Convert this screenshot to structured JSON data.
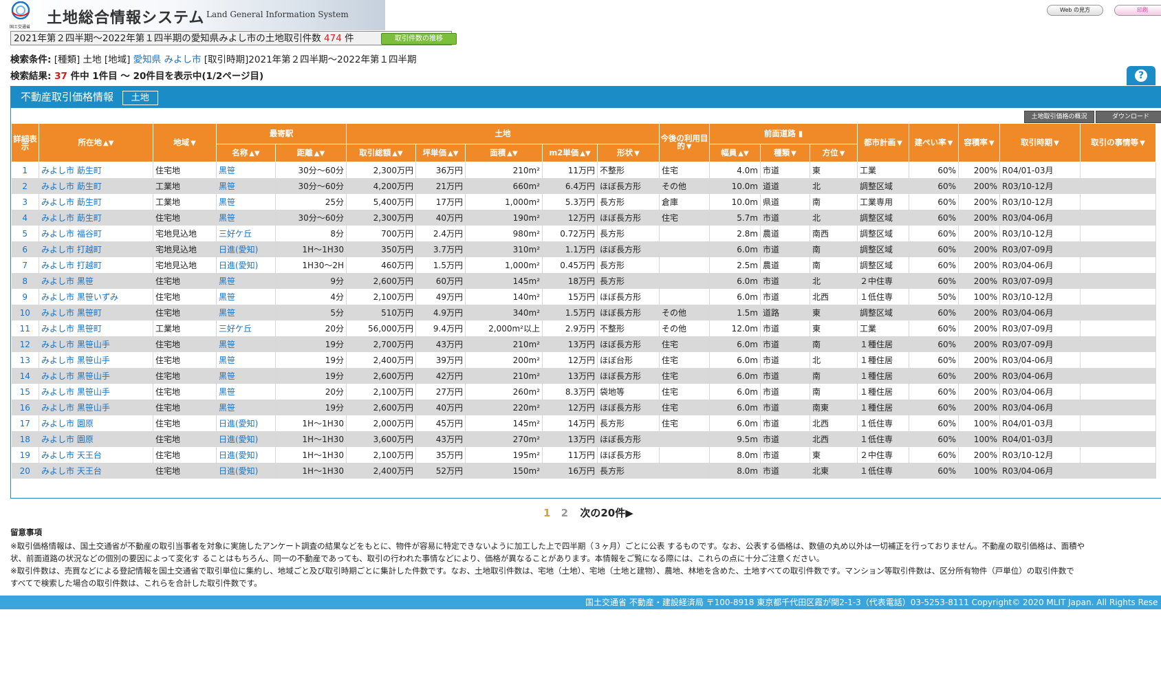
{
  "header": {
    "title": "土地総合情報システム",
    "subtitle": "Land General Information System",
    "ministry_logo_text": "国土交通省",
    "btn_web": "Web の見方",
    "btn_print": "印刷"
  },
  "summary": {
    "text_before": "2021年第２四半期〜2022年第１四半期の愛知県みよし市の土地取引件数",
    "count": "474",
    "unit": "件",
    "trend_button": "取引件数の推移"
  },
  "conditions": {
    "label": "検索条件:",
    "type": "[種類] 土地",
    "region_label": "[地域]",
    "pref": "愛知県",
    "city": "みよし市",
    "period": "[取引時期]2021年第２四半期〜2022年第１四半期"
  },
  "result": {
    "label": "検索結果:",
    "count": "37",
    "text": "件中 1件目 〜 20件目を表示中(1/2ページ目)"
  },
  "panel": {
    "title": "不動産取引価格情報",
    "tag": "土地",
    "overview_button": "土地取引価格の概況",
    "download_button": "ダウンロード"
  },
  "columns": {
    "detail": "詳細表示",
    "location": "所在地",
    "district": "地域",
    "station_group": "最寄駅",
    "station_name": "名称",
    "distance": "距離",
    "land_group": "土地",
    "total": "取引総額",
    "tsubo": "坪単価",
    "area": "面積",
    "m2price": "m2単価",
    "shape": "形状",
    "future_use": "今後の利用目的",
    "road_group": "前面道路",
    "width": "幅員",
    "road_type": "種類",
    "direction": "方位",
    "city_plan": "都市計画",
    "coverage": "建ぺい率",
    "far": "容積率",
    "period": "取引時期",
    "circumstances": "取引の事情等"
  },
  "rows": [
    {
      "no": "1",
      "loc": "みよし市 莇生町",
      "dist": "住宅地",
      "st": "黒笹",
      "d": "30分〜60分",
      "total": "2,300万円",
      "tsubo": "36万円",
      "area": "210m²",
      "m2": "11万円",
      "shape": "不整形",
      "use": "住宅",
      "w": "4.0m",
      "rt": "市道",
      "dir": "東",
      "plan": "工業",
      "cov": "60%",
      "far": "200%",
      "per": "R04/01-03月"
    },
    {
      "no": "2",
      "loc": "みよし市 莇生町",
      "dist": "工業地",
      "st": "黒笹",
      "d": "30分〜60分",
      "total": "4,200万円",
      "tsubo": "21万円",
      "area": "660m²",
      "m2": "6.4万円",
      "shape": "ほぼ長方形",
      "use": "その他",
      "w": "10.0m",
      "rt": "道道",
      "dir": "北",
      "plan": "調整区域",
      "cov": "60%",
      "far": "200%",
      "per": "R03/10-12月"
    },
    {
      "no": "3",
      "loc": "みよし市 莇生町",
      "dist": "工業地",
      "st": "黒笹",
      "d": "25分",
      "total": "5,400万円",
      "tsubo": "17万円",
      "area": "1,000m²",
      "m2": "5.3万円",
      "shape": "長方形",
      "use": "倉庫",
      "w": "10.0m",
      "rt": "県道",
      "dir": "南",
      "plan": "工業専用",
      "cov": "60%",
      "far": "200%",
      "per": "R03/10-12月"
    },
    {
      "no": "4",
      "loc": "みよし市 莇生町",
      "dist": "住宅地",
      "st": "黒笹",
      "d": "30分〜60分",
      "total": "2,300万円",
      "tsubo": "40万円",
      "area": "190m²",
      "m2": "12万円",
      "shape": "ほぼ長方形",
      "use": "住宅",
      "w": "5.7m",
      "rt": "市道",
      "dir": "北",
      "plan": "調整区域",
      "cov": "60%",
      "far": "200%",
      "per": "R03/04-06月"
    },
    {
      "no": "5",
      "loc": "みよし市 福谷町",
      "dist": "宅地見込地",
      "st": "三好ケ丘",
      "d": "8分",
      "total": "700万円",
      "tsubo": "2.4万円",
      "area": "980m²",
      "m2": "0.72万円",
      "shape": "長方形",
      "use": "",
      "w": "2.8m",
      "rt": "農道",
      "dir": "南西",
      "plan": "調整区域",
      "cov": "60%",
      "far": "200%",
      "per": "R03/10-12月"
    },
    {
      "no": "6",
      "loc": "みよし市 打越町",
      "dist": "宅地見込地",
      "st": "日進(愛知)",
      "d": "1H〜1H30",
      "total": "350万円",
      "tsubo": "3.7万円",
      "area": "310m²",
      "m2": "1.1万円",
      "shape": "ほぼ長方形",
      "use": "",
      "w": "6.0m",
      "rt": "市道",
      "dir": "南",
      "plan": "調整区域",
      "cov": "60%",
      "far": "200%",
      "per": "R03/07-09月"
    },
    {
      "no": "7",
      "loc": "みよし市 打越町",
      "dist": "宅地見込地",
      "st": "日進(愛知)",
      "d": "1H30〜2H",
      "total": "460万円",
      "tsubo": "1.5万円",
      "area": "1,000m²",
      "m2": "0.45万円",
      "shape": "長方形",
      "use": "",
      "w": "2.5m",
      "rt": "農道",
      "dir": "南",
      "plan": "調整区域",
      "cov": "60%",
      "far": "200%",
      "per": "R03/04-06月"
    },
    {
      "no": "8",
      "loc": "みよし市 黒笹",
      "dist": "住宅地",
      "st": "黒笹",
      "d": "9分",
      "total": "2,600万円",
      "tsubo": "60万円",
      "area": "145m²",
      "m2": "18万円",
      "shape": "長方形",
      "use": "",
      "w": "6.0m",
      "rt": "市道",
      "dir": "北",
      "plan": "２中住専",
      "cov": "60%",
      "far": "200%",
      "per": "R03/07-09月"
    },
    {
      "no": "9",
      "loc": "みよし市 黒笹いずみ",
      "dist": "住宅地",
      "st": "黒笹",
      "d": "4分",
      "total": "2,100万円",
      "tsubo": "49万円",
      "area": "140m²",
      "m2": "15万円",
      "shape": "ほぼ長方形",
      "use": "",
      "w": "6.0m",
      "rt": "市道",
      "dir": "北西",
      "plan": "１低住専",
      "cov": "50%",
      "far": "100%",
      "per": "R03/10-12月"
    },
    {
      "no": "10",
      "loc": "みよし市 黒笹町",
      "dist": "住宅地",
      "st": "黒笹",
      "d": "5分",
      "total": "510万円",
      "tsubo": "4.9万円",
      "area": "340m²",
      "m2": "1.5万円",
      "shape": "ほぼ長方形",
      "use": "その他",
      "w": "1.5m",
      "rt": "道路",
      "dir": "東",
      "plan": "調整区域",
      "cov": "60%",
      "far": "200%",
      "per": "R03/04-06月"
    },
    {
      "no": "11",
      "loc": "みよし市 黒笹町",
      "dist": "工業地",
      "st": "三好ケ丘",
      "d": "20分",
      "total": "56,000万円",
      "tsubo": "9.4万円",
      "area": "2,000m²以上",
      "m2": "2.9万円",
      "shape": "不整形",
      "use": "その他",
      "w": "12.0m",
      "rt": "市道",
      "dir": "東",
      "plan": "工業",
      "cov": "60%",
      "far": "200%",
      "per": "R03/07-09月"
    },
    {
      "no": "12",
      "loc": "みよし市 黒笹山手",
      "dist": "住宅地",
      "st": "黒笹",
      "d": "19分",
      "total": "2,700万円",
      "tsubo": "43万円",
      "area": "210m²",
      "m2": "13万円",
      "shape": "ほぼ長方形",
      "use": "住宅",
      "w": "6.0m",
      "rt": "市道",
      "dir": "南",
      "plan": "１種住居",
      "cov": "60%",
      "far": "200%",
      "per": "R03/07-09月"
    },
    {
      "no": "13",
      "loc": "みよし市 黒笹山手",
      "dist": "住宅地",
      "st": "黒笹",
      "d": "19分",
      "total": "2,400万円",
      "tsubo": "39万円",
      "area": "200m²",
      "m2": "12万円",
      "shape": "ほぼ台形",
      "use": "住宅",
      "w": "6.0m",
      "rt": "市道",
      "dir": "北",
      "plan": "１種住居",
      "cov": "60%",
      "far": "200%",
      "per": "R03/04-06月"
    },
    {
      "no": "14",
      "loc": "みよし市 黒笹山手",
      "dist": "住宅地",
      "st": "黒笹",
      "d": "19分",
      "total": "2,600万円",
      "tsubo": "42万円",
      "area": "210m²",
      "m2": "13万円",
      "shape": "ほぼ長方形",
      "use": "住宅",
      "w": "6.0m",
      "rt": "市道",
      "dir": "南",
      "plan": "１種住居",
      "cov": "60%",
      "far": "200%",
      "per": "R03/04-06月"
    },
    {
      "no": "15",
      "loc": "みよし市 黒笹山手",
      "dist": "住宅地",
      "st": "黒笹",
      "d": "20分",
      "total": "2,100万円",
      "tsubo": "27万円",
      "area": "260m²",
      "m2": "8.3万円",
      "shape": "袋地等",
      "use": "住宅",
      "w": "6.0m",
      "rt": "市道",
      "dir": "南",
      "plan": "１種住居",
      "cov": "60%",
      "far": "200%",
      "per": "R03/04-06月"
    },
    {
      "no": "16",
      "loc": "みよし市 黒笹山手",
      "dist": "住宅地",
      "st": "黒笹",
      "d": "19分",
      "total": "2,600万円",
      "tsubo": "40万円",
      "area": "220m²",
      "m2": "12万円",
      "shape": "ほぼ長方形",
      "use": "住宅",
      "w": "6.0m",
      "rt": "市道",
      "dir": "南東",
      "plan": "１種住居",
      "cov": "60%",
      "far": "200%",
      "per": "R03/04-06月"
    },
    {
      "no": "17",
      "loc": "みよし市 園原",
      "dist": "住宅地",
      "st": "日進(愛知)",
      "d": "1H〜1H30",
      "total": "2,000万円",
      "tsubo": "45万円",
      "area": "145m²",
      "m2": "14万円",
      "shape": "長方形",
      "use": "住宅",
      "w": "6.0m",
      "rt": "市道",
      "dir": "北西",
      "plan": "１低住専",
      "cov": "60%",
      "far": "100%",
      "per": "R04/01-03月"
    },
    {
      "no": "18",
      "loc": "みよし市 園原",
      "dist": "住宅地",
      "st": "日進(愛知)",
      "d": "1H〜1H30",
      "total": "3,600万円",
      "tsubo": "43万円",
      "area": "270m²",
      "m2": "13万円",
      "shape": "ほぼ長方形",
      "use": "",
      "w": "9.5m",
      "rt": "市道",
      "dir": "北西",
      "plan": "１低住専",
      "cov": "60%",
      "far": "100%",
      "per": "R04/01-03月"
    },
    {
      "no": "19",
      "loc": "みよし市 天王台",
      "dist": "住宅地",
      "st": "日進(愛知)",
      "d": "1H〜1H30",
      "total": "2,100万円",
      "tsubo": "35万円",
      "area": "195m²",
      "m2": "11万円",
      "shape": "ほぼ長方形",
      "use": "",
      "w": "8.0m",
      "rt": "市道",
      "dir": "東",
      "plan": "２中住専",
      "cov": "60%",
      "far": "200%",
      "per": "R03/10-12月"
    },
    {
      "no": "20",
      "loc": "みよし市 天王台",
      "dist": "住宅地",
      "st": "日進(愛知)",
      "d": "1H〜1H30",
      "total": "2,400万円",
      "tsubo": "52万円",
      "area": "150m²",
      "m2": "16万円",
      "shape": "長方形",
      "use": "",
      "w": "8.0m",
      "rt": "市道",
      "dir": "北東",
      "plan": "１低住専",
      "cov": "60%",
      "far": "100%",
      "per": "R03/04-06月"
    }
  ],
  "pager": {
    "current": "1",
    "other": "2",
    "next": "次の20件▶"
  },
  "notes": {
    "title": "留意事項",
    "line1": "※取引価格情報は、国土交通省が不動産の取引当事者を対象に実施したアンケート調査の結果などをもとに、物件が容易に特定できないように加工した上で四半期（３ヶ月）ごとに公表 するものです。なお、公表する価格は、数値の丸め以外は一切補正を行っておりません。不動産の取引価格は、面積や",
    "line2": "状、前面道路の状況などの個別の要因によって変化す ることはもちろん、同一の不動産であっても、取引の行われた事情などにより、価格が異なることがあります。本情報をご覧になる際には、これらの点に十分ご注意ください。",
    "line3": "※取引件数は、売買などによる登記情報を国土交通省で取引単位に集約し、地域ごと及び取引時期ごとに集計した件数です。なお、土地取引件数は、宅地（土地）、宅地（土地と建物）、農地、林地を含めた、土地すべての取引件数です。マンション等取引件数は、区分所有物件（戸単位）の取引件数で",
    "line4": "すべてで検索した場合の取引件数は、これらを合計した取引件数です。"
  },
  "footer": "国土交通省 不動産・建設経済局 〒100-8918 東京都千代田区霞が関2-1-3（代表電話）03-5253-8111 Copyright© 2020 MLIT Japan. All Rights Rese"
}
